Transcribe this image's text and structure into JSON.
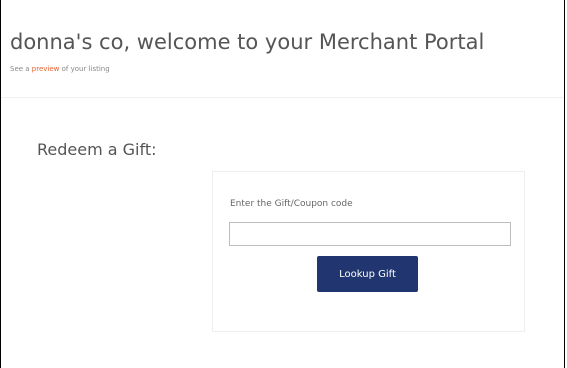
{
  "header": {
    "title": "donna's co, welcome to your Merchant Portal",
    "preview_prefix": "See a ",
    "preview_link": "preview",
    "preview_suffix": " of your listing"
  },
  "redeem": {
    "section_title": "Redeem a Gift:",
    "field_label": "Enter the Gift/Coupon code",
    "input_value": "",
    "input_placeholder": "",
    "button_label": "Lookup Gift"
  },
  "colors": {
    "link_accent": "#e8622c",
    "button_background": "#213670",
    "button_text": "#ffffff",
    "title_text": "#555555"
  }
}
